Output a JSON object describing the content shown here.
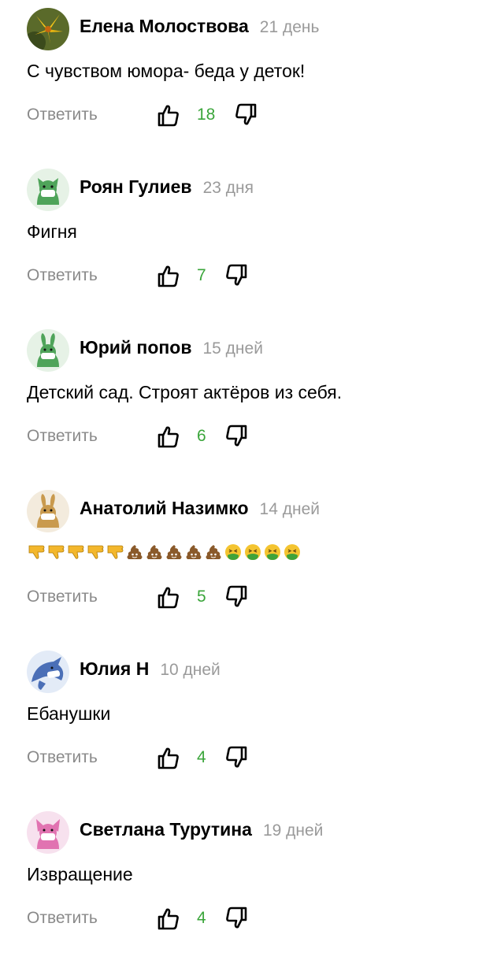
{
  "labels": {
    "reply": "Ответить"
  },
  "comments": [
    {
      "author": "Елена Молоствова",
      "time": "21 день",
      "text": "С чувством юмора- беда у деток!",
      "likes": "18",
      "avatar_icon": "lily-flower-avatar-icon"
    },
    {
      "author": "Роян Гулиев",
      "time": "23 дня",
      "text": "Фигня",
      "likes": "7",
      "avatar_icon": "green-cat-mask-avatar-icon"
    },
    {
      "author": "Юрий попов",
      "time": "15 дней",
      "text": "Детский сад. Строят актёров из себя.",
      "likes": "6",
      "avatar_icon": "green-rabbit-mask-avatar-icon"
    },
    {
      "author": "Анатолий Назимко",
      "time": "14 дней",
      "text": "",
      "likes": "5",
      "avatar_icon": "tan-rabbit-mask-avatar-icon",
      "emojis": [
        "thumbs-down",
        "thumbs-down",
        "thumbs-down",
        "thumbs-down",
        "thumbs-down",
        "pile-of-poo",
        "pile-of-poo",
        "pile-of-poo",
        "pile-of-poo",
        "pile-of-poo",
        "nauseated-face",
        "nauseated-face",
        "nauseated-face",
        "nauseated-face"
      ]
    },
    {
      "author": "Юлия Н",
      "time": "10 дней",
      "text": "Ебанушки",
      "likes": "4",
      "avatar_icon": "blue-dolphin-mask-avatar-icon"
    },
    {
      "author": "Светлана Турутина",
      "time": "19 дней",
      "text": "Извращение",
      "likes": "4",
      "avatar_icon": "pink-fox-mask-avatar-icon"
    }
  ],
  "colors": {
    "like_count": "#3aa53a",
    "meta": "#9a9a9a",
    "reply": "#8a8a8a"
  }
}
